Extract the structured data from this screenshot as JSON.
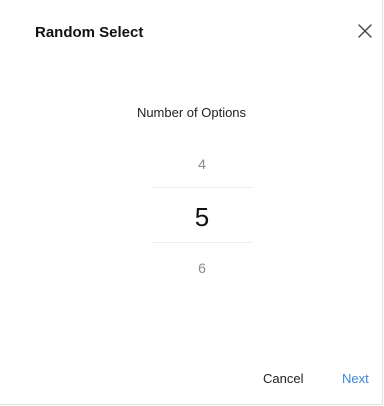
{
  "dialog": {
    "title": "Random Select",
    "close_icon": "close-icon"
  },
  "picker": {
    "label": "Number of Options",
    "previous_value": "4",
    "selected_value": "5",
    "next_value": "6"
  },
  "actions": {
    "cancel_label": "Cancel",
    "next_label": "Next"
  },
  "colors": {
    "accent": "#3d86d9",
    "text_primary": "#111111",
    "text_muted": "#8a8a8a",
    "divider": "#ececec"
  }
}
